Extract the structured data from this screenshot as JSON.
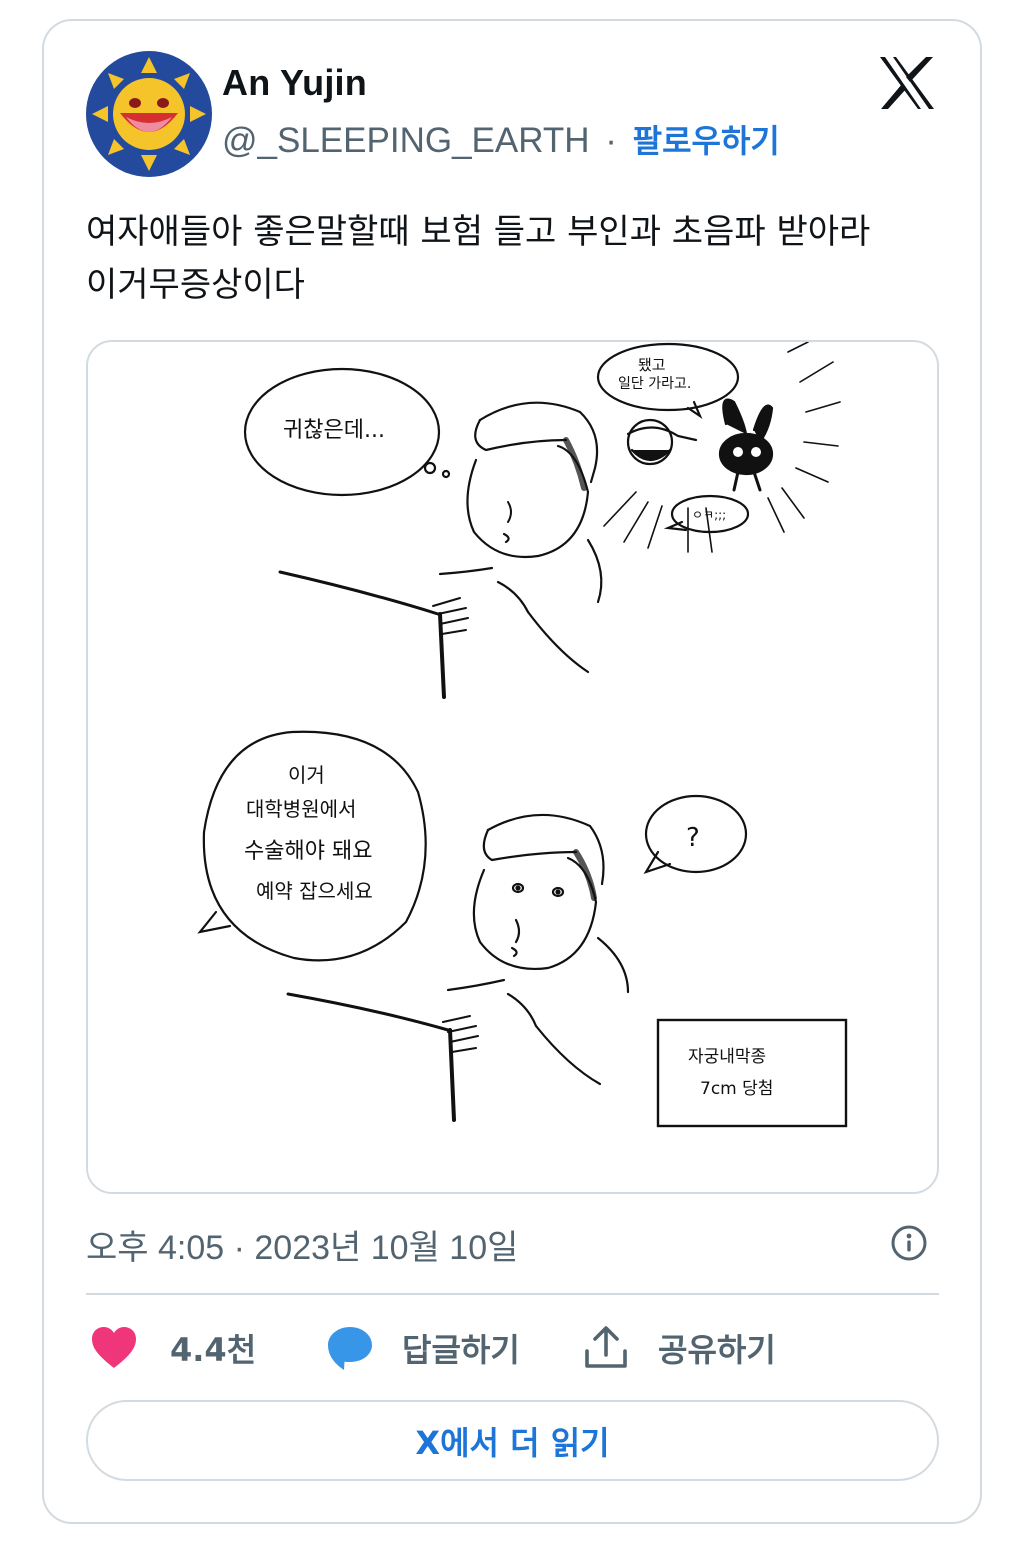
{
  "author": {
    "name": "An Yujin",
    "handle": "@_SLEEPING_EARTH",
    "separator": "·",
    "follow_label": "팔로우하기"
  },
  "tweet": {
    "text": "여자애들아 좋은말할때 보험 들고 부인과 초음파 받아라\n이거무증상이다",
    "timestamp": "오후 4:05 · 2023년 10월 10일"
  },
  "comic": {
    "panel1": {
      "thought": "귀찮은데...",
      "side_speech": "됐고\n일단 가라고.",
      "small_speech": "ㅇㅋ;;;"
    },
    "panel2": {
      "doctor_speech": [
        "이거",
        "대학병원에서",
        "수술해야 돼요",
        "예약 잡으세요"
      ],
      "question": "?",
      "caption": [
        "자궁내막종",
        "7cm 당첨"
      ]
    }
  },
  "actions": {
    "like_count": "4.4천",
    "reply_label": "답글하기",
    "share_label": "공유하기"
  },
  "read_more_label": "X에서 더 읽기",
  "colors": {
    "accent": "#1d75d8",
    "like": "#f0367a",
    "reply": "#3896e8",
    "muted": "#536471",
    "border": "#d3dbe1"
  },
  "icons": [
    "sun-avatar-icon",
    "x-logo-icon",
    "info-icon",
    "heart-icon",
    "reply-bubble-icon",
    "share-icon"
  ]
}
